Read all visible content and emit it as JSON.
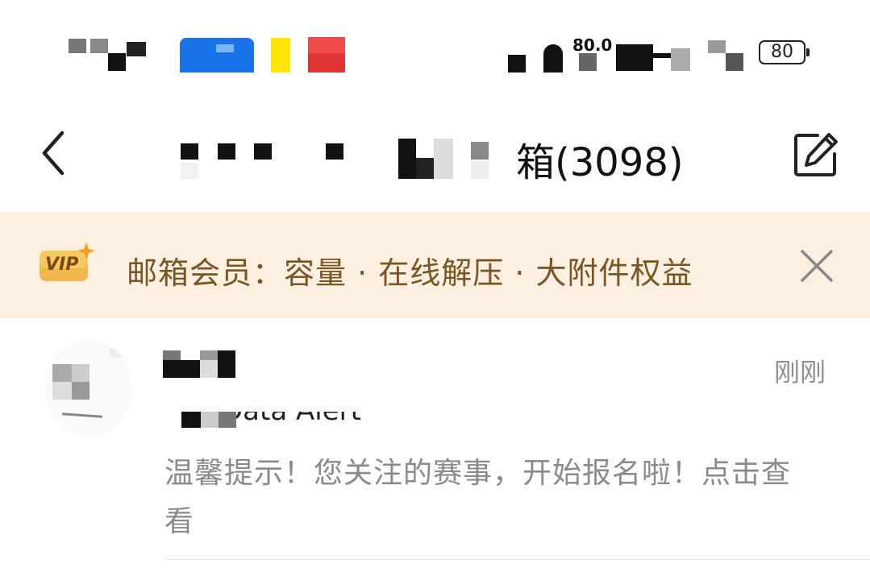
{
  "status_bar": {
    "net_speed": "80.0",
    "battery_level": "80",
    "icons": [
      "clock-icon",
      "app-icon-blue",
      "app-icon-yellow",
      "app-icon-red",
      "alarm-icon",
      "hd-icon",
      "wifi-icon",
      "signal-icon",
      "battery-icon"
    ]
  },
  "nav": {
    "title": "箱(3098)",
    "back_icon": "chevron-left-icon",
    "compose_icon": "compose-icon"
  },
  "vip_banner": {
    "badge": "VIP",
    "text": "邮箱会员：容量 · 在线解压 · 大附件权益",
    "close_icon": "close-icon"
  },
  "mail": {
    "time": "刚刚",
    "subject_fragment": "Data Alert",
    "preview": "温馨提示！您关注的赛事，开始报名啦！点击查看"
  },
  "colors": {
    "banner_bg": "#fdf0e0",
    "banner_text": "#7a5524",
    "vip_gold": "#f0b848",
    "muted_text": "#8a8a8a"
  }
}
